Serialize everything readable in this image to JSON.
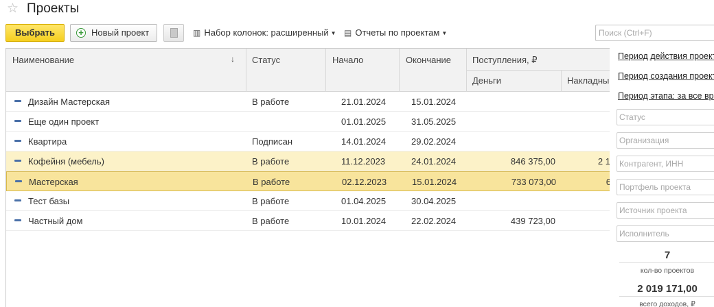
{
  "header": {
    "title": "Проекты",
    "favorite_icon": "star-icon"
  },
  "toolbar": {
    "select_label": "Выбрать",
    "new_project_label": "Новый проект",
    "columns_menu_label": "Набор колонок: расширенный",
    "reports_menu_label": "Отчеты по проектам",
    "search_placeholder": "Поиск (Ctrl+F)"
  },
  "columns": {
    "name": "Наименование",
    "status": "Статус",
    "start": "Начало",
    "end": "Окончание",
    "income": "Поступления, ₽",
    "money": "Деньги",
    "overhead": "Накладные"
  },
  "rows": [
    {
      "name": "Дизайн Мастерская",
      "status": "В работе",
      "start": "21.01.2024",
      "end": "15.01.2024",
      "money": "",
      "overhead": ""
    },
    {
      "name": "Еще один проект",
      "status": "",
      "start": "01.01.2025",
      "end": "31.05.2025",
      "money": "",
      "overhead": ""
    },
    {
      "name": "Квартира",
      "status": "Подписан",
      "start": "14.01.2024",
      "end": "29.02.2024",
      "money": "",
      "overhead": ""
    },
    {
      "name": "Кофейня (мебель)",
      "status": "В работе",
      "start": "11.12.2023",
      "end": "24.01.2024",
      "money": "846 375,00",
      "overhead": "2 1"
    },
    {
      "name": "Мастерская",
      "status": "В работе",
      "start": "02.12.2023",
      "end": "15.01.2024",
      "money": "733 073,00",
      "overhead": "6"
    },
    {
      "name": "Тест базы",
      "status": "В работе",
      "start": "01.04.2025",
      "end": "30.04.2025",
      "money": "",
      "overhead": ""
    },
    {
      "name": "Частный дом",
      "status": "В работе",
      "start": "10.01.2024",
      "end": "22.02.2024",
      "money": "439 723,00",
      "overhead": ""
    }
  ],
  "side_panel": {
    "period_action": "Период действия проекта",
    "period_created": "Период создания проекта",
    "period_stage": "Период этапа: за все время",
    "filter_status": "Статус",
    "filter_org": "Организация",
    "filter_contractor": "Контрагент, ИНН",
    "filter_portfolio": "Портфель проекта",
    "filter_source": "Источник проекта",
    "filter_executor": "Исполнитель",
    "count_value": "7",
    "count_label": "кол-во проектов",
    "income_value": "2 019 171,00",
    "income_label": "всего доходов, ₽"
  }
}
